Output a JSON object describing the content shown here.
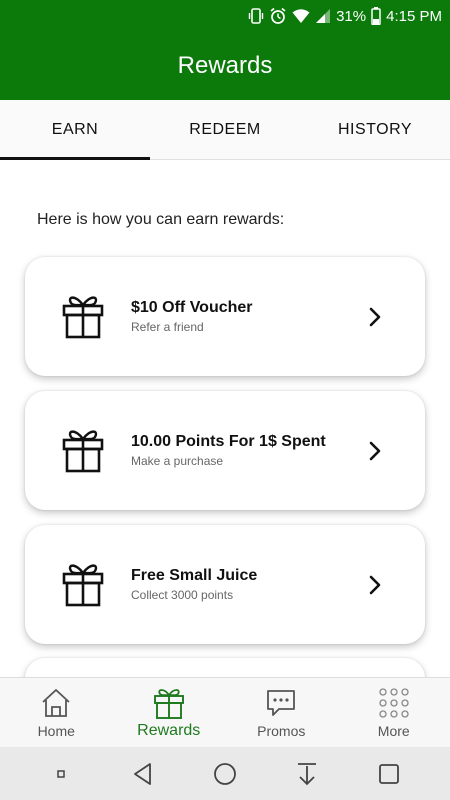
{
  "status_bar": {
    "battery": "31%",
    "time": "4:15 PM",
    "icons": [
      "vibrate-icon",
      "alarm-icon",
      "wifi-icon",
      "signal-icon",
      "battery-icon"
    ]
  },
  "app_bar": {
    "title": "Rewards"
  },
  "tabs": [
    {
      "label": "EARN",
      "active": true
    },
    {
      "label": "REDEEM",
      "active": false
    },
    {
      "label": "HISTORY",
      "active": false
    }
  ],
  "intro": "Here is how you can earn rewards:",
  "cards": [
    {
      "title": "$10 Off Voucher",
      "subtitle": "Refer a friend",
      "icon": "gift-icon"
    },
    {
      "title": "10.00 Points For 1$ Spent",
      "subtitle": "Make a purchase",
      "icon": "gift-icon"
    },
    {
      "title": "Free Small Juice",
      "subtitle": "Collect 3000 points",
      "icon": "gift-icon"
    }
  ],
  "bottom_nav": [
    {
      "label": "Home",
      "icon": "home-icon",
      "active": false
    },
    {
      "label": "Rewards",
      "icon": "gift-icon",
      "active": true
    },
    {
      "label": "Promos",
      "icon": "message-icon",
      "active": false
    },
    {
      "label": "More",
      "icon": "grid-icon",
      "active": false
    }
  ],
  "system_nav": [
    "recents-dot-icon",
    "back-icon",
    "home-circle-icon",
    "download-icon",
    "overview-square-icon"
  ],
  "colors": {
    "brand_green": "#0b7a0b",
    "active_nav": "#1f7a1f"
  }
}
